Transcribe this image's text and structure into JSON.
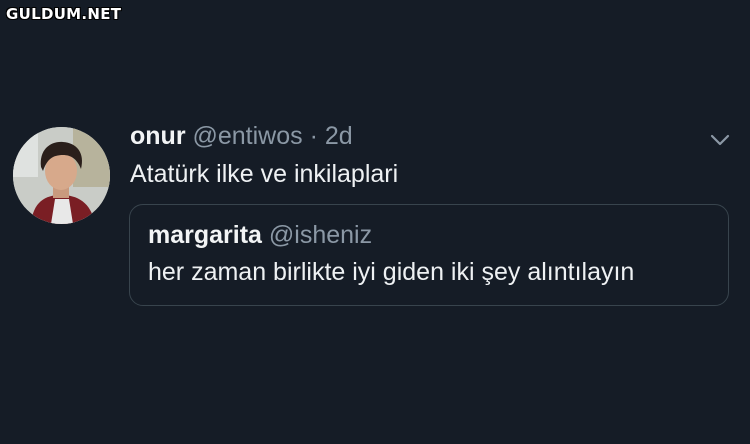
{
  "watermark": "GULDUM.NET",
  "tweet": {
    "display_name": "onur",
    "handle": "@entiwos",
    "separator": "·",
    "time": "2d",
    "text": "Atatürk ilke ve inkilaplari",
    "menu_icon": "chevron-down-icon"
  },
  "quoted_tweet": {
    "display_name": "margarita",
    "handle": "@isheniz",
    "text": "her zaman birlikte iyi giden iki şey alıntılayın"
  },
  "colors": {
    "background": "#151c26",
    "text_primary": "#eef1f3",
    "text_secondary": "#8b98a5",
    "border": "#38444d"
  }
}
